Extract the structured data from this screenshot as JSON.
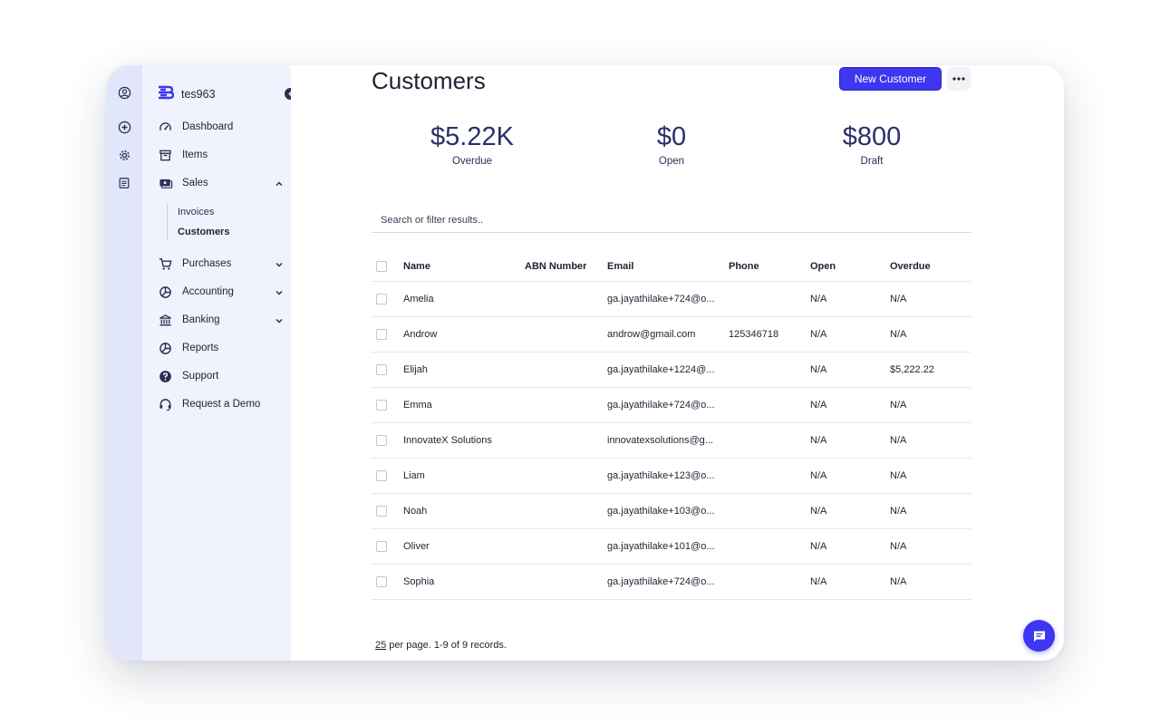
{
  "sidebar": {
    "org": "tes963",
    "nav": [
      {
        "label": "Dashboard",
        "icon": "gauge-icon"
      },
      {
        "label": "Items",
        "icon": "archive-icon"
      },
      {
        "label": "Sales",
        "icon": "sales-icon"
      },
      {
        "label": "Purchases",
        "icon": "cart-icon"
      },
      {
        "label": "Accounting",
        "icon": "pie-chart-icon"
      },
      {
        "label": "Banking",
        "icon": "bank-icon"
      },
      {
        "label": "Reports",
        "icon": "reports-icon"
      },
      {
        "label": "Support",
        "icon": "help-icon"
      },
      {
        "label": "Request a Demo",
        "icon": "headset-icon"
      }
    ],
    "sales_sub": [
      "Invoices",
      "Customers"
    ]
  },
  "header": {
    "title": "Customers",
    "new_button": "New Customer"
  },
  "stats": [
    {
      "value": "$5.22K",
      "label": "Overdue"
    },
    {
      "value": "$0",
      "label": "Open"
    },
    {
      "value": "$800",
      "label": "Draft"
    }
  ],
  "search": {
    "placeholder": "Search or filter results.."
  },
  "table": {
    "columns": [
      "Name",
      "ABN Number",
      "Email",
      "Phone",
      "Open",
      "Overdue"
    ],
    "rows": [
      {
        "name": "Amelia",
        "abn": "",
        "email": "ga.jayathilake+724@o...",
        "phone": "",
        "open": "N/A",
        "overdue": "N/A"
      },
      {
        "name": "Androw",
        "abn": "",
        "email": "androw@gmail.com",
        "phone": "125346718",
        "open": "N/A",
        "overdue": "N/A"
      },
      {
        "name": "Elijah",
        "abn": "",
        "email": "ga.jayathilake+1224@...",
        "phone": "",
        "open": "N/A",
        "overdue": "$5,222.22"
      },
      {
        "name": "Emma",
        "abn": "",
        "email": "ga.jayathilake+724@o...",
        "phone": "",
        "open": "N/A",
        "overdue": "N/A"
      },
      {
        "name": "InnovateX Solutions",
        "abn": "",
        "email": "innovatexsolutions@g...",
        "phone": "",
        "open": "N/A",
        "overdue": "N/A"
      },
      {
        "name": "Liam",
        "abn": "",
        "email": "ga.jayathilake+123@o...",
        "phone": "",
        "open": "N/A",
        "overdue": "N/A"
      },
      {
        "name": "Noah",
        "abn": "",
        "email": "ga.jayathilake+103@o...",
        "phone": "",
        "open": "N/A",
        "overdue": "N/A"
      },
      {
        "name": "Oliver",
        "abn": "",
        "email": "ga.jayathilake+101@o...",
        "phone": "",
        "open": "N/A",
        "overdue": "N/A"
      },
      {
        "name": "Sophia",
        "abn": "",
        "email": "ga.jayathilake+724@o...",
        "phone": "",
        "open": "N/A",
        "overdue": "N/A"
      }
    ]
  },
  "pagination": {
    "per_page": "25",
    "summary": " per page. 1-9 of 9 records."
  },
  "colors": {
    "accent": "#3d37f0",
    "rail": "#e2e6fb",
    "sidebar": "#f0f2fd"
  }
}
